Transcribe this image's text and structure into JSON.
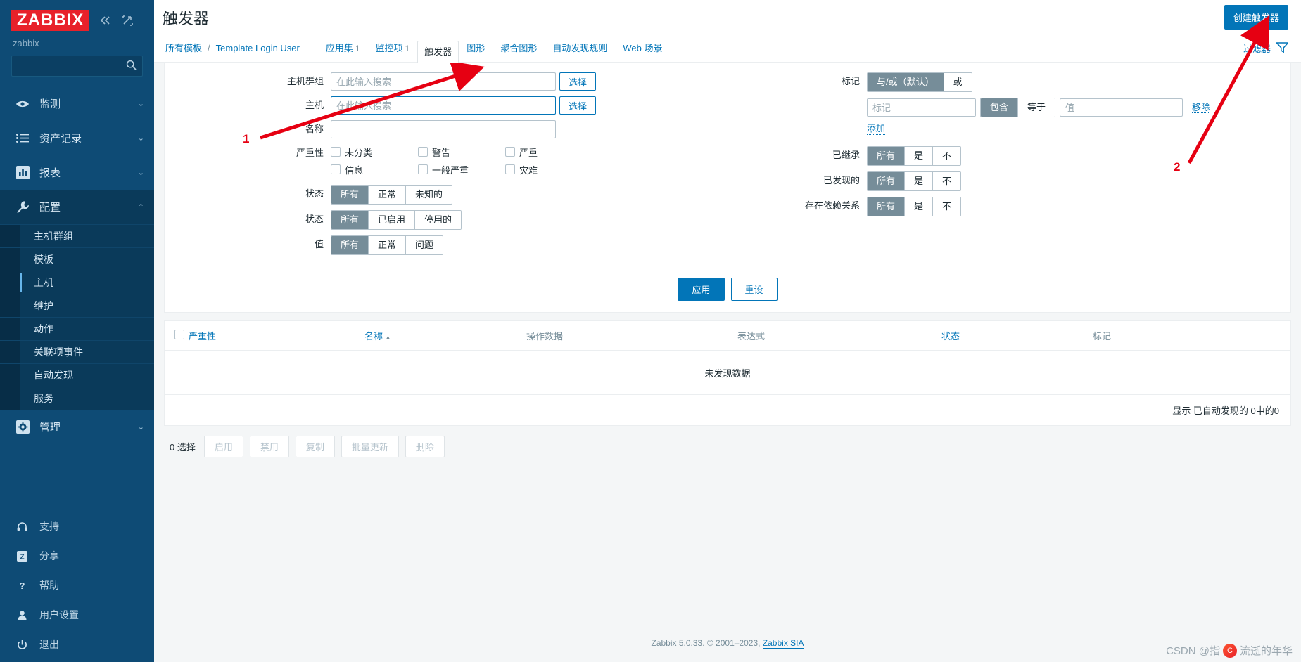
{
  "sidebar": {
    "logo_text": "ZABBIX",
    "collapse_icon": "chevron-double-left-icon",
    "expand_icon": "expand-icon",
    "server_name": "zabbix",
    "search_placeholder": "",
    "search_value": "",
    "nav": [
      {
        "label": "监测",
        "icon": "eye-icon",
        "chevron": "⌄",
        "active": false
      },
      {
        "label": "资产记录",
        "icon": "list-icon",
        "chevron": "⌄",
        "active": false
      },
      {
        "label": "报表",
        "icon": "chart-bar-icon",
        "chevron": "⌄",
        "active": false
      },
      {
        "label": "配置",
        "icon": "wrench-icon",
        "chevron": "⌃",
        "active": true
      },
      {
        "label": "管理",
        "icon": "gear-icon",
        "chevron": "⌄",
        "active": false
      }
    ],
    "submenu": [
      {
        "label": "主机群组",
        "active": false
      },
      {
        "label": "模板",
        "active": false
      },
      {
        "label": "主机",
        "active": true
      },
      {
        "label": "维护",
        "active": false
      },
      {
        "label": "动作",
        "active": false
      },
      {
        "label": "关联项事件",
        "active": false
      },
      {
        "label": "自动发现",
        "active": false
      },
      {
        "label": "服务",
        "active": false
      }
    ],
    "bottom": [
      {
        "label": "支持",
        "icon": "headset-icon"
      },
      {
        "label": "分享",
        "icon": "zabbix-z-icon"
      },
      {
        "label": "帮助",
        "icon": "question-icon"
      },
      {
        "label": "用户设置",
        "icon": "user-icon"
      },
      {
        "label": "退出",
        "icon": "power-icon"
      }
    ]
  },
  "header": {
    "title": "触发器",
    "create_button": "创建触发器"
  },
  "breadcrumb": {
    "all_templates": "所有模板",
    "separator": "/",
    "template_name": "Template Login User",
    "tabs": [
      {
        "label": "应用集",
        "count": "1",
        "selected": false
      },
      {
        "label": "监控项",
        "count": "1",
        "selected": false
      },
      {
        "label": "触发器",
        "count": "",
        "selected": true
      },
      {
        "label": "图形",
        "count": "",
        "selected": false
      },
      {
        "label": "聚合图形",
        "count": "",
        "selected": false
      },
      {
        "label": "自动发现规则",
        "count": "",
        "selected": false
      },
      {
        "label": "Web 场景",
        "count": "",
        "selected": false
      }
    ],
    "filter_tab_label": "过滤器",
    "filter_icon": "funnel-icon"
  },
  "filter": {
    "left": {
      "host_group": {
        "label": "主机群组",
        "placeholder": "在此输入搜索",
        "value": "",
        "select_button": "选择"
      },
      "host": {
        "label": "主机",
        "placeholder": "在此输入搜索",
        "value": "",
        "select_button": "选择",
        "focused": true
      },
      "name": {
        "label": "名称",
        "placeholder": "",
        "value": ""
      },
      "severity": {
        "label": "严重性",
        "options": [
          {
            "label": "未分类",
            "checked": false
          },
          {
            "label": "警告",
            "checked": false
          },
          {
            "label": "严重",
            "checked": false
          },
          {
            "label": "信息",
            "checked": false
          },
          {
            "label": "一般严重",
            "checked": false
          },
          {
            "label": "灾难",
            "checked": false
          }
        ]
      },
      "state": {
        "label": "状态",
        "options": [
          "所有",
          "正常",
          "未知的"
        ],
        "selected": "所有"
      },
      "status": {
        "label": "状态",
        "options": [
          "所有",
          "已启用",
          "停用的"
        ],
        "selected": "所有"
      },
      "value": {
        "label": "值",
        "options": [
          "所有",
          "正常",
          "问题"
        ],
        "selected": "所有"
      }
    },
    "right": {
      "tags": {
        "label": "标记",
        "operator_options": [
          "与/或（默认）",
          "或"
        ],
        "operator_selected": "与/或（默认）",
        "tag_placeholder": "标记",
        "tag_value": "",
        "match_options": [
          "包含",
          "等于"
        ],
        "match_selected": "包含",
        "value_placeholder": "值",
        "value_value": "",
        "remove_link": "移除",
        "add_link": "添加"
      },
      "inherited": {
        "label": "已继承",
        "options": [
          "所有",
          "是",
          "不"
        ],
        "selected": "所有"
      },
      "discovered": {
        "label": "已发现的",
        "options": [
          "所有",
          "是",
          "不"
        ],
        "selected": "所有"
      },
      "dependency": {
        "label": "存在依赖关系",
        "options": [
          "所有",
          "是",
          "不"
        ],
        "selected": "所有"
      }
    },
    "apply_button": "应用",
    "reset_button": "重设"
  },
  "table": {
    "columns": [
      {
        "label": "严重性",
        "link": true,
        "sorted": false
      },
      {
        "label": "名称",
        "link": true,
        "sorted": true,
        "arrow": "▲"
      },
      {
        "label": "操作数据",
        "link": false,
        "sorted": false
      },
      {
        "label": "表达式",
        "link": false,
        "sorted": false
      },
      {
        "label": "状态",
        "link": true,
        "sorted": false
      },
      {
        "label": "标记",
        "link": false,
        "sorted": false
      }
    ],
    "empty_message": "未发现数据",
    "footer_text": "显示 已自动发现的 0中的0",
    "select_all_icon": "checkbox-icon"
  },
  "actions": {
    "selection_text": "0 选择",
    "buttons": [
      "启用",
      "禁用",
      "复制",
      "批量更新",
      "删除"
    ]
  },
  "footer": {
    "text_before": "Zabbix 5.0.33. © 2001–2023, ",
    "link_text": "Zabbix SIA"
  },
  "watermark": {
    "prefix": "CSDN @指",
    "suffix": "流逝的年华"
  },
  "annotations": [
    {
      "number": "1"
    },
    {
      "number": "2"
    }
  ],
  "colors": {
    "accent": "#0275b8",
    "sidebar": "#0e4b75",
    "brand_red": "#e8212a",
    "segment_on": "#768d99",
    "annotation": "#e60012"
  }
}
